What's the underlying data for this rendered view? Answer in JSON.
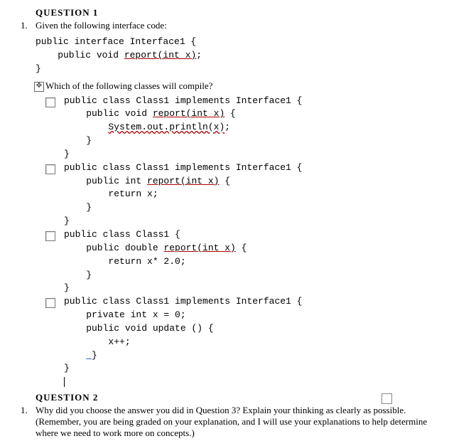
{
  "q1": {
    "heading": "QUESTION 1",
    "number": "1.",
    "intro": "Given the following interface code:",
    "iface": {
      "l1a": "public interface Interface1 {",
      "l2a": "    public void ",
      "l2b": "report(int x)",
      "l2c": ";",
      "l3": "}"
    },
    "prompt": "Which of the following classes will compile?",
    "opts": [
      {
        "l1": "public class Class1 implements Interface1 {",
        "l2a": "    public void ",
        "l2b": "report(int x)",
        "l2c": " {",
        "l3a": "        ",
        "l3b": "System.out.println(x)",
        "l3c": ";",
        "l4": "    }",
        "l5": "}"
      },
      {
        "l1": "public class Class1 implements Interface1 {",
        "l2a": "    public int ",
        "l2b": "report(int x)",
        "l2c": " {",
        "l3": "        return x;",
        "l4": "    }",
        "l5": "}"
      },
      {
        "l1": "public class Class1 {",
        "l2a": "    public double ",
        "l2b": "report(int x)",
        "l2c": " {",
        "l3": "        return x* 2.0;",
        "l4": "    }",
        "l5": "}"
      },
      {
        "l1": "public class Class1 implements Interface1 {",
        "l2": "    private int x = 0;",
        "l3": "    public void update () {",
        "l4": "        x++;",
        "l5a": "    ",
        "l5b": " ",
        "l5c": "}",
        "l6": "}"
      }
    ]
  },
  "q2": {
    "heading": "QUESTION 2",
    "number": "1.",
    "text": "Why did you choose the answer you did in Question 3? Explain your thinking as clearly as possible. (Remember, you are being graded on your explanation, and I will use your explanations to help determine where we need to work more on concepts.)"
  }
}
